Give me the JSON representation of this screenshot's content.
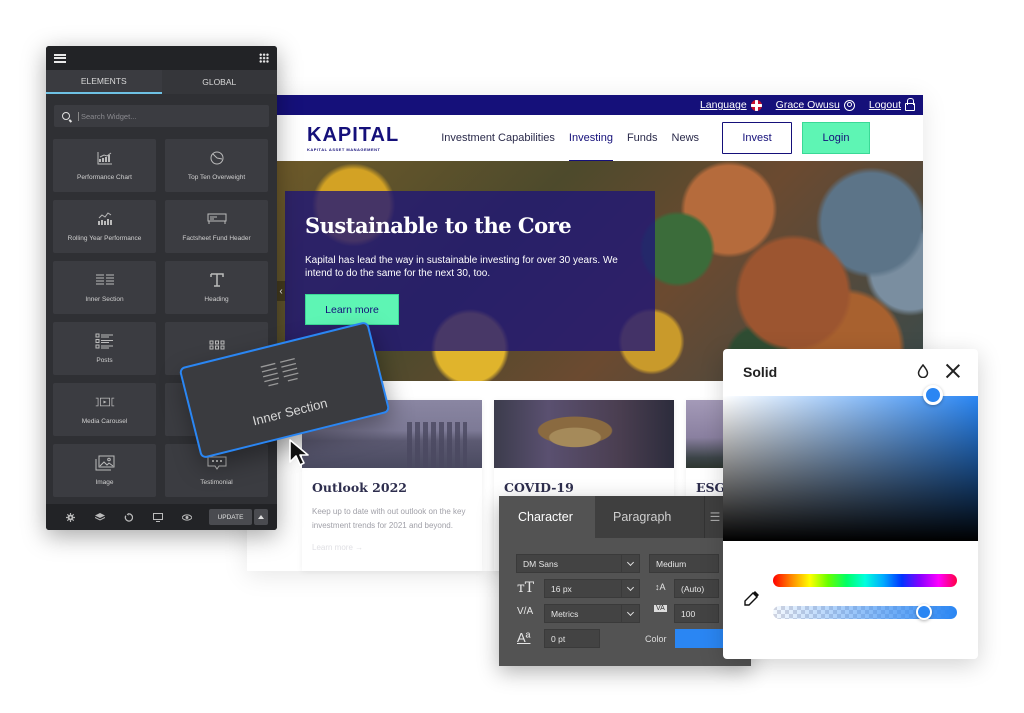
{
  "builder_panel": {
    "tabs": [
      {
        "label": "ELEMENTS",
        "active": true
      },
      {
        "label": "GLOBAL",
        "active": false
      }
    ],
    "search": {
      "placeholder": "Search Widget...",
      "value": ""
    },
    "widgets": [
      {
        "label": "Performance Chart",
        "icon": "chart-icon"
      },
      {
        "label": "Top Ten Overweight",
        "icon": "pie-chart-icon"
      },
      {
        "label": "Rolling Year Performance",
        "icon": "line-bar-chart-icon"
      },
      {
        "label": "Factsheet Fund Header",
        "icon": "header-icon"
      },
      {
        "label": "Inner Section",
        "icon": "columns-icon"
      },
      {
        "label": "Heading",
        "icon": "heading-icon"
      },
      {
        "label": "Posts",
        "icon": "posts-icon"
      },
      {
        "label": "",
        "icon": "grid-icon"
      },
      {
        "label": "Media Carousel",
        "icon": "carousel-icon"
      },
      {
        "label": "",
        "icon": "blank-icon"
      },
      {
        "label": "Image",
        "icon": "image-icon"
      },
      {
        "label": "Testimonial",
        "icon": "testimonial-icon"
      }
    ],
    "footer": {
      "icons": [
        "settings-icon",
        "layers-icon",
        "history-icon",
        "responsive-icon",
        "preview-icon"
      ],
      "update_label": "UPDATE"
    },
    "dragged_widget": {
      "label": "Inner Section"
    }
  },
  "website": {
    "topbar": {
      "language_label": "Language",
      "user_name": "Grace Owusu",
      "logout_label": "Logout"
    },
    "logo": {
      "main": "KAPITAL",
      "sub": "KAPITAL ASSET MANAGEMENT"
    },
    "nav": [
      {
        "label": "Investment Capabilities",
        "active": false
      },
      {
        "label": "Investing",
        "active": true
      },
      {
        "label": "Funds",
        "active": false
      },
      {
        "label": "News",
        "active": false
      }
    ],
    "invest_label": "Invest",
    "login_label": "Login",
    "hero": {
      "title": "Sustainable to the Core",
      "text": "Kapital has lead the way in sustainable investing for over 30 years. We intend to do the same for the next 30, too.",
      "button_label": "Learn more"
    },
    "cards": [
      {
        "title": "Outlook 2022",
        "text": "Keep up to date with out outlook on the key investment trends for 2021 and beyond.",
        "link": "Learn more →"
      },
      {
        "title": "COVID-19",
        "text": "",
        "link": ""
      },
      {
        "title": "ESG,",
        "text": "",
        "link": ""
      }
    ]
  },
  "character_panel": {
    "tabs": [
      {
        "label": "Character",
        "active": true
      },
      {
        "label": "Paragraph",
        "active": false
      }
    ],
    "font_family": "DM Sans",
    "font_weight": "Medium",
    "font_size": "16 px",
    "leading": "(Auto)",
    "kerning": "Metrics",
    "tracking": "100",
    "baseline_shift": "0 pt",
    "color_label": "Color",
    "color_value": "#2a86f3"
  },
  "color_picker": {
    "title": "Solid",
    "selected_color": "#2a86f3",
    "opacity_percent": 85
  },
  "colors": {
    "brand_navy": "#15107a",
    "accent_green": "#5ef5b4",
    "selection_blue": "#2a86f3"
  }
}
